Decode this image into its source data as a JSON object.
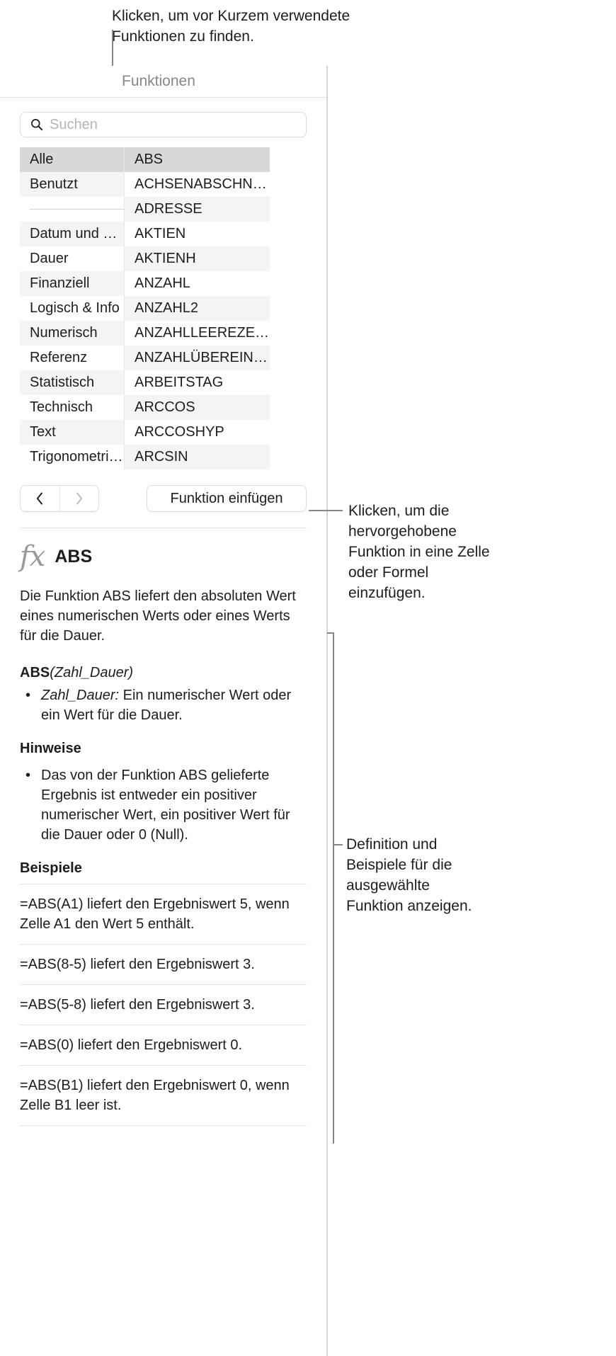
{
  "callouts": {
    "top": "Klicken, um vor Kurzem verwendete Funktionen zu finden.",
    "insert": "Klicken, um die hervorgehobene Funktion in eine Zelle oder Formel einzufügen.",
    "detail": "Definition und Beispiele für die ausgewählte Funktion anzeigen."
  },
  "panel": {
    "title": "Funktionen",
    "search": {
      "placeholder": "Suchen",
      "value": ""
    },
    "categories": [
      {
        "label": "Alle",
        "selected": true
      },
      {
        "label": "Benutzt",
        "selected": false
      },
      {
        "label": "",
        "separator": true
      },
      {
        "label": "Datum und Zeit",
        "selected": false
      },
      {
        "label": "Dauer",
        "selected": false
      },
      {
        "label": "Finanziell",
        "selected": false
      },
      {
        "label": "Logisch & Info",
        "selected": false
      },
      {
        "label": "Numerisch",
        "selected": false
      },
      {
        "label": "Referenz",
        "selected": false
      },
      {
        "label": "Statistisch",
        "selected": false
      },
      {
        "label": "Technisch",
        "selected": false
      },
      {
        "label": "Text",
        "selected": false
      },
      {
        "label": "Trigonometrisch",
        "selected": false
      }
    ],
    "functions": [
      {
        "label": "ABS",
        "selected": true
      },
      {
        "label": "ACHSENABSCHNI…",
        "selected": false
      },
      {
        "label": "ADRESSE",
        "selected": false
      },
      {
        "label": "AKTIEN",
        "selected": false
      },
      {
        "label": "AKTIENH",
        "selected": false
      },
      {
        "label": "ANZAHL",
        "selected": false
      },
      {
        "label": "ANZAHL2",
        "selected": false
      },
      {
        "label": "ANZAHLLEEREZE…",
        "selected": false
      },
      {
        "label": "ANZAHLÜBEREIN…",
        "selected": false
      },
      {
        "label": "ARBEITSTAG",
        "selected": false
      },
      {
        "label": "ARCCOS",
        "selected": false
      },
      {
        "label": "ARCCOSHYP",
        "selected": false
      },
      {
        "label": "ARCSIN",
        "selected": false
      }
    ],
    "nav": {
      "back": "‹",
      "forward": "›"
    },
    "insert_button": "Funktion einfügen"
  },
  "detail": {
    "fx_glyph": "fx",
    "name": "ABS",
    "description": "Die Funktion ABS liefert den absoluten Wert eines numerischen Werts oder eines Werts für die Dauer.",
    "syntax_name": "ABS",
    "syntax_args": "(Zahl_Dauer)",
    "arguments": [
      {
        "term": "Zahl_Dauer:",
        "text": " Ein numerischer Wert oder ein Wert für die Dauer."
      }
    ],
    "notes_heading": "Hinweise",
    "notes": [
      "Das von der Funktion ABS gelieferte Ergebnis ist entweder ein positiver numerischer Wert, ein positiver Wert für die Dauer oder 0 (Null)."
    ],
    "examples_heading": "Beispiele",
    "examples": [
      "=ABS(A1) liefert den Ergebniswert 5, wenn Zelle A1 den Wert 5 enthält.",
      "=ABS(8-5) liefert den Ergebniswert 3.",
      "=ABS(5-8) liefert den Ergebniswert 3.",
      "=ABS(0) liefert den Ergebniswert 0.",
      "=ABS(B1) liefert den Ergebniswert 0, wenn Zelle B1 leer ist."
    ]
  },
  "colors": {
    "selected_row": "#d8d8d8",
    "stripe": "#f4f4f4",
    "border": "#e3e3e3",
    "leader": "#86868b",
    "placeholder": "#b4b4b8"
  }
}
